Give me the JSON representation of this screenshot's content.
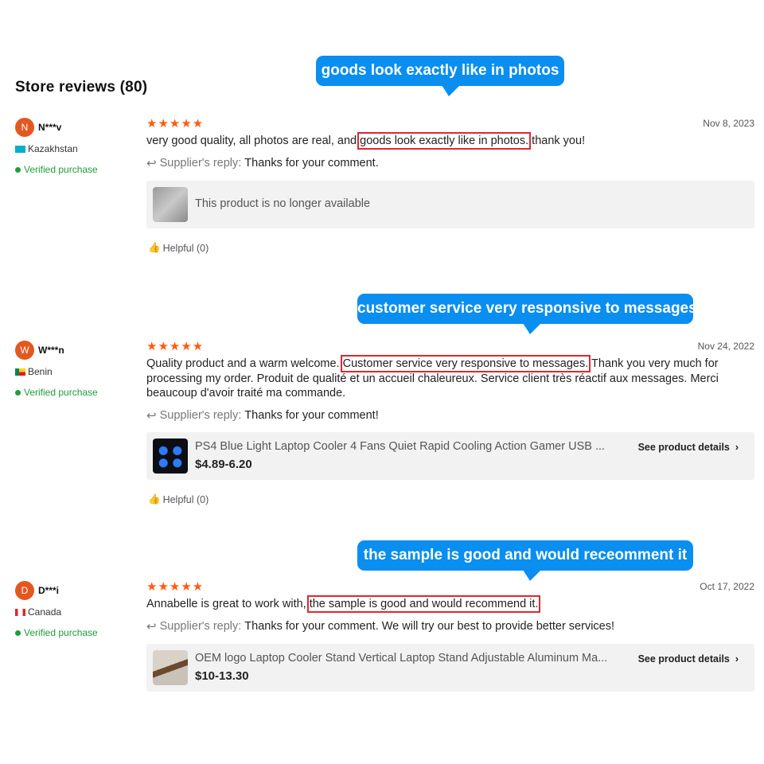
{
  "store": {
    "title": "Store reviews (80)"
  },
  "callouts": [
    {
      "text": "goods look exactly like in photos"
    },
    {
      "text": "customer service very responsive to messages"
    },
    {
      "text": "the sample is good and would receomment it"
    }
  ],
  "reviews": [
    {
      "avatar_letter": "N",
      "avatar_color": "#e4571e",
      "user": "N***v",
      "country": "Kazakhstan",
      "verified": "Verified purchase",
      "stars": "★★★★★",
      "date": "Nov 8, 2023",
      "text_before": "very good quality, all photos are real, and ",
      "text_highlight": "goods look exactly like in photos.",
      "text_after": " thank you!",
      "reply_label": "Supplier's reply:",
      "reply_text": "Thanks for your comment.",
      "product": {
        "name": "This product is no longer available"
      },
      "helpful": "Helpful (0)"
    },
    {
      "avatar_letter": "W",
      "avatar_color": "#e4571e",
      "user": "W***n",
      "country": "Benin",
      "verified": "Verified purchase",
      "stars": "★★★★★",
      "date": "Nov 24, 2022",
      "text_before": "Quality product and a warm welcome. ",
      "text_highlight": "Customer service very responsive to messages.",
      "text_after": " Thank you very much for processing my order. Produit de qualité et un accueil chaleureux. Service client très réactif aux messages. Merci beaucoup d'avoir traité ma commande.",
      "reply_label": "Supplier's reply:",
      "reply_text": "Thanks for your comment!",
      "product": {
        "name": "PS4 Blue Light Laptop Cooler 4 Fans Quiet Rapid Cooling Action Gamer USB ...",
        "price": "$4.89-6.20",
        "details": "See product details"
      },
      "helpful": "Helpful (0)"
    },
    {
      "avatar_letter": "D",
      "avatar_color": "#e4571e",
      "user": "D***i",
      "country": "Canada",
      "verified": "Verified purchase",
      "stars": "★★★★★",
      "date": "Oct 17, 2022",
      "text_before": "Annabelle is great to work with, ",
      "text_highlight": "the sample is good and would recommend it.",
      "text_after": "",
      "reply_label": "Supplier's reply:",
      "reply_text": "Thanks for your comment. We will try our best to provide better services!",
      "product": {
        "name": "OEM logo Laptop Cooler Stand Vertical Laptop Stand Adjustable Aluminum Ma...",
        "price": "$10-13.30",
        "details": "See product details"
      }
    }
  ],
  "icons": {
    "reply": "reply-arrow-icon",
    "helpful": "thumbs-up-icon",
    "chevron": "chevron-right-icon",
    "verified": "check-circle-icon",
    "star": "star-icon"
  }
}
